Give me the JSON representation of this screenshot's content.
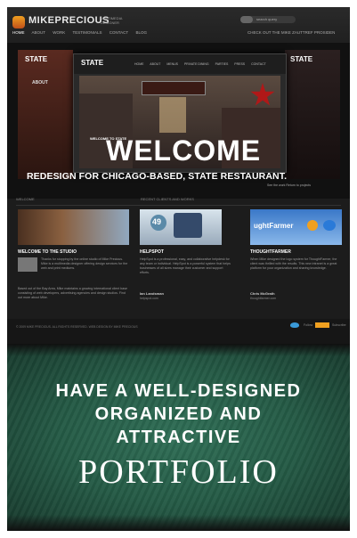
{
  "site": {
    "logo": "MIKEPRECIOUS",
    "logo_sub": "MULTIMEDIA DESIGNER",
    "search_placeholder": "search query",
    "nav": [
      "HOME",
      "ABOUT",
      "WORK",
      "TESTIMONIALS",
      "CONTACT",
      "BLOG"
    ],
    "nav_right": "CHECK OUT THE MIKE ZAUTTREF PROSIDEN"
  },
  "hero": {
    "left_panel_title": "STATE",
    "left_panel_label": "ABOUT",
    "right_panel_title": "STATE",
    "shot_title": "STATE",
    "shot_nav": [
      "HOME",
      "ABOUT",
      "MENUS",
      "PRIVATE DINING",
      "PARTIES",
      "PRESS",
      "CONTACT"
    ],
    "welcome_small": "WELCOME TO STATE",
    "welcome_big": "WELCOME",
    "caption": "REDESIGN FOR CHICAGO-BASED, STATE RESTAURANT.",
    "caption_sub": "See the work    Return to projects"
  },
  "sections": {
    "left_title": "WELCOME",
    "right_title": "RECENT CLIENTS AND WORKS"
  },
  "columns": [
    {
      "heading": "WELCOME TO THE STUDIO",
      "body": "Thanks for stopping by the online studio of Mike Precious. Mike is a multimedia designer offering design services for the web and print mediums.",
      "body2": "Based out of the Bay Area, Mike maintains a growing international client base consisting of web developers, advertising agencies and design studios. Find out more about Mike."
    },
    {
      "heading": "HELPSPOT",
      "body": "HelpSpot is a professional, easy, and collaborative helpdesk for any team or individual. HelpSpot is a powerful system that helps businesses of all sizes manage their customer and support efforts.",
      "meta": "Ian Landsman",
      "meta2": "helpspot.com"
    },
    {
      "heading": "THOUGHTFARMER",
      "body": "When Mike designed the logo system for ThoughtFarmer, the client was thrilled with the results. This new intranet is a great platform for your organization and sharing knowledge.",
      "meta": "Chris McGrath",
      "meta2": "thoughtfarmer.com"
    }
  ],
  "thumbs": {
    "helpspot_badge": "49",
    "thoughtfarmer_logo": "ughtFarmer"
  },
  "footer": {
    "text": "© 2009 MIKE PRECIOUS. ALL RIGHTS RESERVED. WEB DESIGN BY MIKE PRECIOUS",
    "follow": "Follow",
    "rss": "Subscribe"
  },
  "banner": {
    "line1": "HAVE A WELL-DESIGNED",
    "line2": "ORGANIZED AND",
    "line3": "ATTRACTIVE",
    "line4": "PORTFOLIO"
  },
  "colors": {
    "accent": "#f0a020",
    "banner_green": "#245a45",
    "star_red": "#b01818"
  }
}
